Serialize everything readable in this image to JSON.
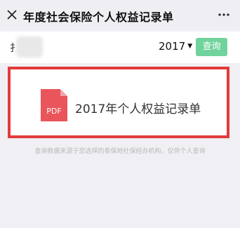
{
  "header": {
    "title": "年度社会保险个人权益记录单",
    "close_icon": "close-icon",
    "more_icon": "more-icon"
  },
  "filter": {
    "name_visible": "扌",
    "year": "2017",
    "query_label": "查询",
    "query_color": "#6fd39b"
  },
  "record": {
    "file_type": "PDF",
    "title": "2017年个人权益记录单",
    "icon_color": "#e9555a",
    "highlight_color": "#e23b3b"
  },
  "footnote": "查询数据来源于您选择的参保地社保经办机构，仅供个人查询"
}
